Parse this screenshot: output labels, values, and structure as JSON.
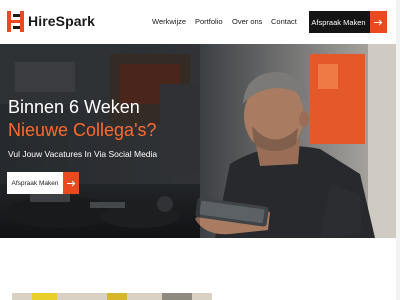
{
  "brand": {
    "name": "HireSpark",
    "logo_icon": "hs-monogram",
    "accent": "#ea4a1d"
  },
  "nav": {
    "items": [
      {
        "label": "Werkwijze"
      },
      {
        "label": "Portfolio"
      },
      {
        "label": "Over ons"
      },
      {
        "label": "Contact"
      }
    ],
    "cta_label": "Afspraak Maken",
    "cta_icon": "arrow-right-icon"
  },
  "hero": {
    "title_line1": "Binnen 6 Weken",
    "title_line2": "Nieuwe Collega's?",
    "subtitle": "Vul Jouw Vacatures In Via Social Media",
    "cta_label": "Afspraak Maken",
    "cta_icon": "arrow-right-icon",
    "title_accent_color": "#ff6a2b"
  }
}
